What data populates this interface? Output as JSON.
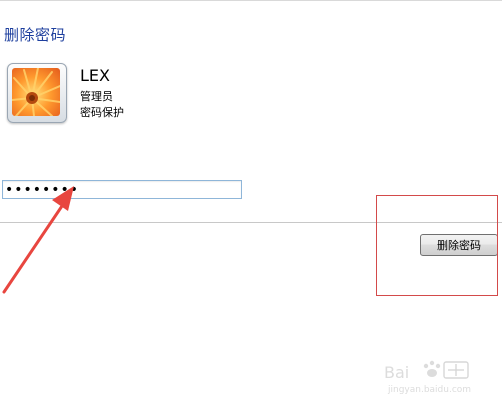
{
  "page": {
    "title": "删除密码"
  },
  "user": {
    "name": "LEX",
    "role": "管理员",
    "status": "密码保护",
    "avatar_icon": "orange-flower-avatar-icon"
  },
  "password": {
    "value": "••••••••"
  },
  "actions": {
    "delete_label": "删除密码"
  },
  "annotations": {
    "arrow_color": "#e8463f",
    "box_color": "#d34a4a"
  },
  "colors": {
    "title": "#1e3f9e",
    "input_border": "#8fb6d9"
  }
}
